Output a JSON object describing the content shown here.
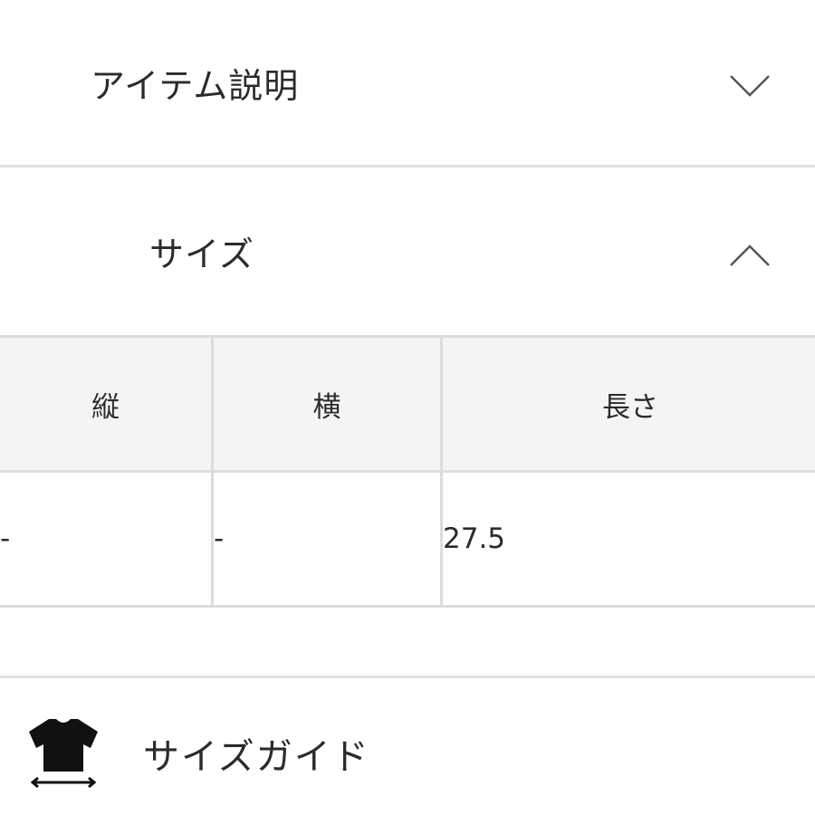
{
  "accordion": {
    "item_description": {
      "label": "アイテム説明",
      "state": "collapsed",
      "icon": "chevron-down-icon"
    },
    "size": {
      "label": "サイズ",
      "state": "expanded",
      "icon": "chevron-up-icon"
    }
  },
  "size_table": {
    "headers": [
      "縦",
      "横",
      "長さ"
    ],
    "rows": [
      [
        "-",
        "-",
        "27.5"
      ]
    ]
  },
  "size_guide": {
    "label": "サイズガイド",
    "icon": "tshirt-measure-icon"
  },
  "colors": {
    "text": "#2b2b2b",
    "border": "#dcdcdc",
    "header_bg": "#f4f4f4"
  }
}
